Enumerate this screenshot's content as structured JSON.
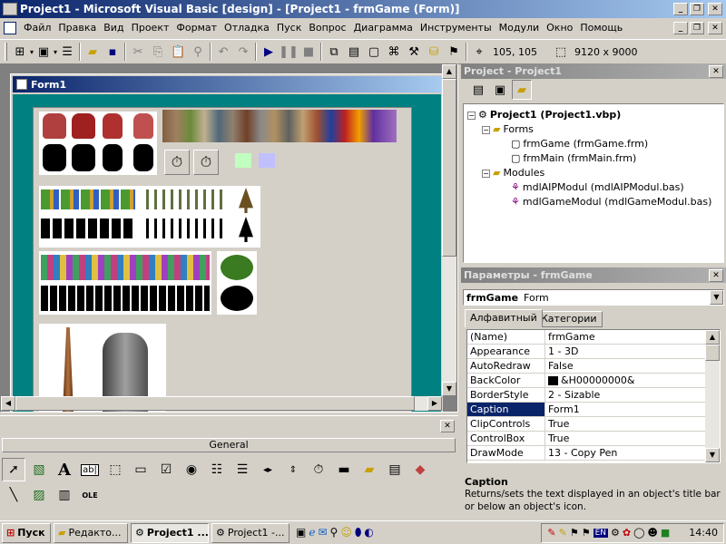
{
  "app": {
    "title": "Project1 - Microsoft Visual Basic [design] - [Project1 - frmGame (Form)]"
  },
  "menu": [
    "Файл",
    "Правка",
    "Вид",
    "Проект",
    "Формат",
    "Отладка",
    "Пуск",
    "Вопрос",
    "Диаграмма",
    "Инструменты",
    "Модули",
    "Окно",
    "Помощь"
  ],
  "toolbar": {
    "position": "105, 105",
    "size": "9120 x 9000"
  },
  "form": {
    "title": "Form1"
  },
  "project": {
    "title": "Project - Project1",
    "root": "Project1 (Project1.vbp)",
    "forms_folder": "Forms",
    "form1": "frmGame (frmGame.frm)",
    "form2": "frmMain (frmMain.frm)",
    "modules_folder": "Modules",
    "module1": "mdlAIPModul (mdlAIPModul.bas)",
    "module2": "mdlGameModul (mdlGameModul.bas)"
  },
  "properties": {
    "title": "Параметры - frmGame",
    "object_name": "frmGame",
    "object_type": "Form",
    "tab_alpha": "Алфавитный",
    "tab_cat": "Категории",
    "rows": [
      {
        "name": "(Name)",
        "value": "frmGame"
      },
      {
        "name": "Appearance",
        "value": "1 - 3D"
      },
      {
        "name": "AutoRedraw",
        "value": "False"
      },
      {
        "name": "BackColor",
        "value": "&H00000000&"
      },
      {
        "name": "BorderStyle",
        "value": "2 - Sizable"
      },
      {
        "name": "Caption",
        "value": "Form1"
      },
      {
        "name": "ClipControls",
        "value": "True"
      },
      {
        "name": "ControlBox",
        "value": "True"
      },
      {
        "name": "DrawMode",
        "value": "13 - Copy Pen"
      }
    ],
    "selected_index": 5,
    "desc_title": "Caption",
    "desc_text": "Returns/sets the text displayed in an object's title bar or below an object's icon."
  },
  "toolbox": {
    "title": "General"
  },
  "taskbar": {
    "start": "Пуск",
    "buttons": [
      "Редакто...",
      "Project1 ...",
      "Project1 -..."
    ],
    "lang": "EN",
    "clock": "14:40"
  },
  "colors": {
    "title_active": "#0a246a",
    "form_teal": "#008080",
    "selected_row": "#0a246a"
  }
}
